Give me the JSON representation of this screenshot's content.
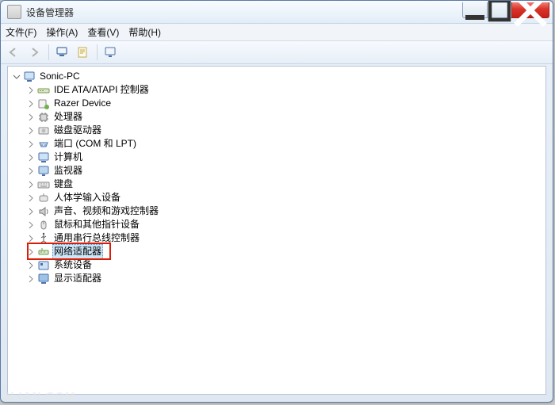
{
  "window": {
    "title": "设备管理器"
  },
  "menubar": {
    "file": "文件(F)",
    "action": "操作(A)",
    "view": "查看(V)",
    "help": "帮助(H)"
  },
  "toolbar": {
    "back": "back",
    "forward": "forward",
    "properties": "properties",
    "console": "console",
    "help": "help"
  },
  "tree": {
    "root": "Sonic-PC",
    "items": [
      {
        "icon": "ide",
        "label": "IDE ATA/ATAPI 控制器"
      },
      {
        "icon": "razer",
        "label": "Razer Device"
      },
      {
        "icon": "cpu",
        "label": "处理器"
      },
      {
        "icon": "disk",
        "label": "磁盘驱动器"
      },
      {
        "icon": "port",
        "label": "端口 (COM 和 LPT)"
      },
      {
        "icon": "computer",
        "label": "计算机"
      },
      {
        "icon": "monitor",
        "label": "监视器"
      },
      {
        "icon": "keyboard",
        "label": "键盘"
      },
      {
        "icon": "hid",
        "label": "人体学输入设备"
      },
      {
        "icon": "audio",
        "label": "声音、视频和游戏控制器"
      },
      {
        "icon": "mouse",
        "label": "鼠标和其他指针设备"
      },
      {
        "icon": "usb",
        "label": "通用串行总线控制器"
      },
      {
        "icon": "network",
        "label": "网络适配器",
        "highlighted": true
      },
      {
        "icon": "system",
        "label": "系统设备"
      },
      {
        "icon": "display",
        "label": "显示适配器"
      }
    ]
  },
  "watermark": "3LIAN.COM"
}
